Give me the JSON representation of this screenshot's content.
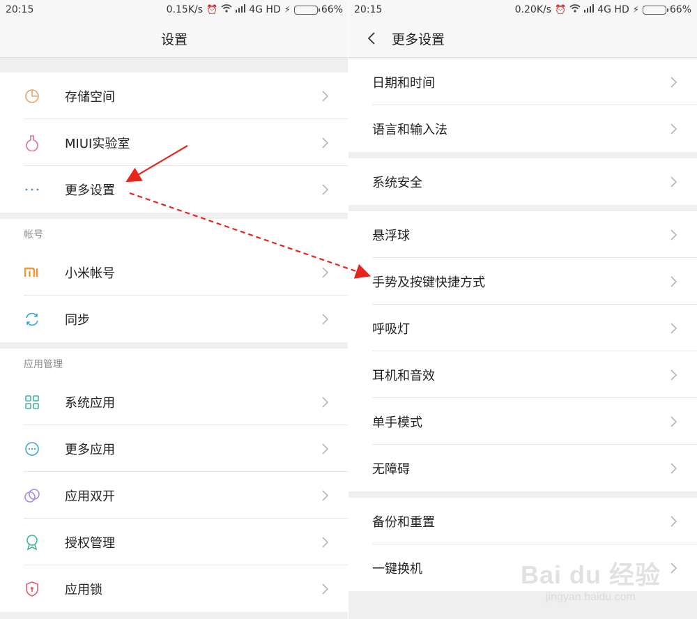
{
  "left": {
    "status": {
      "time": "20:15",
      "speed": "0.15K/s",
      "network": "4G HD",
      "battery": "66%",
      "battery_level": 0.66
    },
    "title": "设置",
    "items_group1": [
      {
        "label": "存储空间",
        "icon": "storage-pie-icon"
      },
      {
        "label": "MIUI实验室",
        "icon": "lab-flask-icon"
      },
      {
        "label": "更多设置",
        "icon": "more-dots-icon"
      }
    ],
    "section_account": "帐号",
    "items_account": [
      {
        "label": "小米帐号",
        "icon": "mi-logo-icon"
      },
      {
        "label": "同步",
        "icon": "sync-icon"
      }
    ],
    "section_apps": "应用管理",
    "items_apps": [
      {
        "label": "系统应用",
        "icon": "grid-apps-icon"
      },
      {
        "label": "更多应用",
        "icon": "more-apps-icon"
      },
      {
        "label": "应用双开",
        "icon": "dual-apps-icon"
      },
      {
        "label": "授权管理",
        "icon": "permission-badge-icon"
      },
      {
        "label": "应用锁",
        "icon": "app-lock-shield-icon"
      }
    ]
  },
  "right": {
    "status": {
      "time": "20:15",
      "speed": "0.20K/s",
      "network": "4G HD",
      "battery": "66%",
      "battery_level": 0.66
    },
    "title": "更多设置",
    "group1": [
      "日期和时间",
      "语言和输入法"
    ],
    "group2": [
      "系统安全"
    ],
    "group3": [
      "悬浮球",
      "手势及按键快捷方式",
      "呼吸灯",
      "耳机和音效",
      "单手模式",
      "无障碍"
    ],
    "group4": [
      "备份和重置",
      "一键换机"
    ]
  },
  "watermark": {
    "main": "Bai du 经验",
    "sub": "jingyan.baidu.com"
  },
  "colors": {
    "annotation_arrow": "#e8241c",
    "chevron": "#b5b5b5",
    "background": "#efefef"
  }
}
